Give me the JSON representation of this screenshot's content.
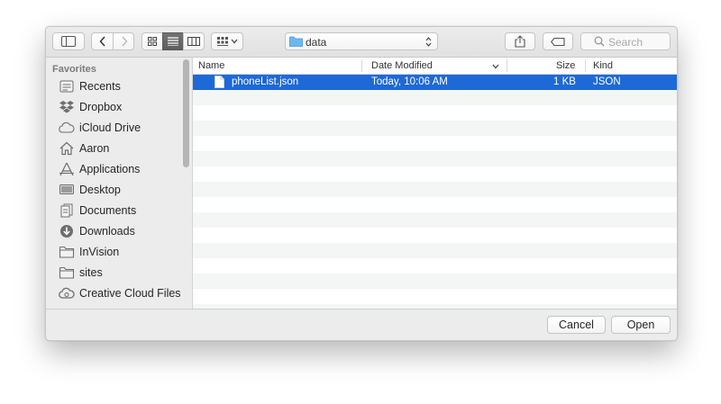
{
  "toolbar": {
    "path_folder": "data",
    "search_placeholder": "Search"
  },
  "sidebar": {
    "heading": "Favorites",
    "items": [
      {
        "label": "Recents",
        "icon": "recents-icon"
      },
      {
        "label": "Dropbox",
        "icon": "dropbox-icon"
      },
      {
        "label": "iCloud Drive",
        "icon": "cloud-icon"
      },
      {
        "label": "Aaron",
        "icon": "home-icon"
      },
      {
        "label": "Applications",
        "icon": "applications-icon"
      },
      {
        "label": "Desktop",
        "icon": "desktop-icon"
      },
      {
        "label": "Documents",
        "icon": "documents-icon"
      },
      {
        "label": "Downloads",
        "icon": "downloads-icon"
      },
      {
        "label": "InVision",
        "icon": "folder-icon"
      },
      {
        "label": "sites",
        "icon": "folder-icon"
      },
      {
        "label": "Creative Cloud Files",
        "icon": "creative-cloud-icon"
      }
    ]
  },
  "columns": {
    "name": "Name",
    "date_modified": "Date Modified",
    "size": "Size",
    "kind": "Kind"
  },
  "files": [
    {
      "name": "phoneList.json",
      "date_modified": "Today, 10:06 AM",
      "size": "1 KB",
      "kind": "JSON",
      "selected": true
    }
  ],
  "buttons": {
    "cancel": "Cancel",
    "open": "Open"
  },
  "colors": {
    "selection": "#1d69d8",
    "folder_blue": "#6cb8ee"
  }
}
